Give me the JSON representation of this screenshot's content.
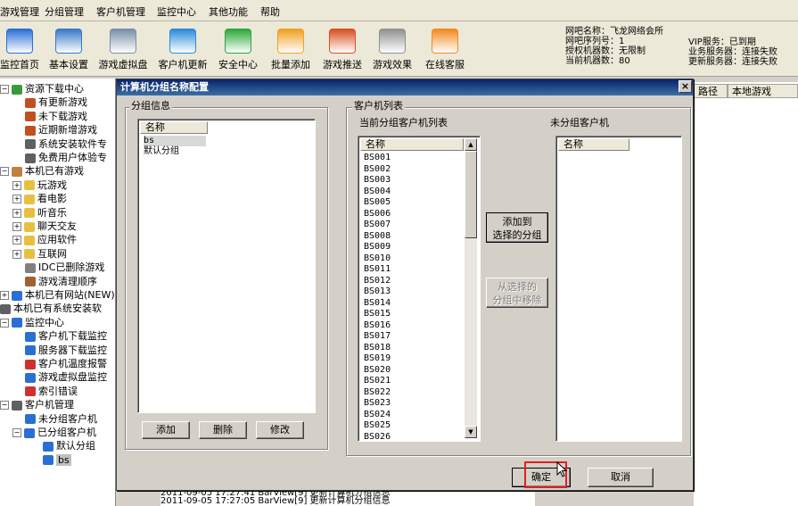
{
  "menubar": [
    "游戏管理",
    "分组管理",
    "客户机管理",
    "监控中心",
    "其他功能",
    "帮助"
  ],
  "toolbar": [
    {
      "label": "监控首页",
      "icon": "monitor-icon",
      "color": "#2a6fd6"
    },
    {
      "label": "基本设置",
      "icon": "gear-icon",
      "color": "#3a78c8"
    },
    {
      "label": "游戏虚拟盘",
      "icon": "disk-icon",
      "color": "#7a8fa8"
    },
    {
      "label": "客户机更新",
      "icon": "refresh-icon",
      "color": "#2c8ad8"
    },
    {
      "label": "安全中心",
      "icon": "shield-icon",
      "color": "#2aa83a"
    },
    {
      "label": "批量添加",
      "icon": "folder-add-icon",
      "color": "#f0a020"
    },
    {
      "label": "游戏推送",
      "icon": "push-icon",
      "color": "#d85020"
    },
    {
      "label": "游戏效果",
      "icon": "gamepad-icon",
      "color": "#909090"
    },
    {
      "label": "在线客服",
      "icon": "chat-icon",
      "color": "#f08a20"
    }
  ],
  "info": {
    "name": "网吧名称：飞龙网络会所",
    "serial": "网吧序列号：1",
    "authorized": "授权机器数：无限制",
    "current": "当前机器数：80",
    "vip": "VIP服务：已到期",
    "business": "业务服务器：连接失败",
    "update": "更新服务器：连接失败"
  },
  "tree": [
    {
      "label": "资源下载中心",
      "exp": "−",
      "color": "#3a9a3a"
    },
    {
      "label": "有更新游戏",
      "color": "#c05020"
    },
    {
      "label": "未下载游戏",
      "color": "#c05020"
    },
    {
      "label": "近期新增游戏",
      "color": "#c05020"
    },
    {
      "label": "系统安装软件专",
      "color": "#606060"
    },
    {
      "label": "免费用户体验专",
      "color": "#606060"
    },
    {
      "label": "本机已有游戏",
      "exp": "−",
      "color": "#c08040"
    },
    {
      "label": "玩游戏",
      "exp": "+",
      "color": "#e8c040"
    },
    {
      "label": "看电影",
      "exp": "+",
      "color": "#e8c040"
    },
    {
      "label": "听音乐",
      "exp": "+",
      "color": "#e8c040"
    },
    {
      "label": "聊天交友",
      "exp": "+",
      "color": "#e8c040"
    },
    {
      "label": "应用软件",
      "exp": "+",
      "color": "#e8c040"
    },
    {
      "label": "互联网",
      "exp": "+",
      "color": "#e8c040"
    },
    {
      "label": "IDC已删除游戏",
      "color": "#808080"
    },
    {
      "label": "游戏清理顺序",
      "color": "#a06030"
    },
    {
      "label": "本机已有网站(NEW)",
      "exp": "+",
      "color": "#2a6fd6"
    },
    {
      "label": "本机已有系统安装软",
      "color": "#606060"
    },
    {
      "label": "监控中心",
      "exp": "−",
      "color": "#2a6fd6"
    },
    {
      "label": "客户机下载监控",
      "color": "#2a6fd6"
    },
    {
      "label": "服务器下载监控",
      "color": "#2a6fd6"
    },
    {
      "label": "客户机温度报警",
      "color": "#d03030"
    },
    {
      "label": "游戏虚拟盘监控",
      "color": "#2a6fd6"
    },
    {
      "label": "索引错误",
      "color": "#d03030"
    },
    {
      "label": "客户机管理",
      "exp": "−",
      "color": "#606060"
    },
    {
      "label": "未分组客户机",
      "color": "#2a6fd6"
    },
    {
      "label": "已分组客户机",
      "exp": "−",
      "color": "#2a6fd6"
    },
    {
      "label": "默认分组",
      "color": "#2a6fd6"
    },
    {
      "label": "bs",
      "color": "#2a6fd6"
    }
  ],
  "bglist": {
    "col1": "路径",
    "col2": "本地游戏"
  },
  "bglog": [
    "2011-09-05 17:27:41  BarView[9] 更新计算机分组信息",
    "2011-09-05 17:27:05  BarView[9] 更新计算机分组信息"
  ],
  "dialog": {
    "title": "计算机分组名称配置",
    "close": "×",
    "group_info_label": "分组信息",
    "groups_header": "名称",
    "groups": [
      "bs",
      "默认分组"
    ],
    "add": "添加",
    "delete": "删除",
    "modify": "修改",
    "client_list_label": "客户机列表",
    "current_group_label": "当前分组客户机列表",
    "ungrouped_label": "未分组客户机",
    "name_header": "名称",
    "ungrouped_header": "名称",
    "clients": [
      "BS001",
      "BS002",
      "BS003",
      "BS004",
      "BS005",
      "BS006",
      "BS007",
      "BS008",
      "BS009",
      "BS010",
      "BS011",
      "BS012",
      "BS013",
      "BS014",
      "BS015",
      "BS016",
      "BS017",
      "BS018",
      "BS019",
      "BS020",
      "BS021",
      "BS022",
      "BS023",
      "BS024",
      "BS025",
      "BS026"
    ],
    "add_to_group_1": "添加到",
    "add_to_group_2": "选择的分组",
    "remove_1": "从选择的",
    "remove_2": "分组中移除",
    "ok": "确定",
    "cancel": "取消"
  }
}
